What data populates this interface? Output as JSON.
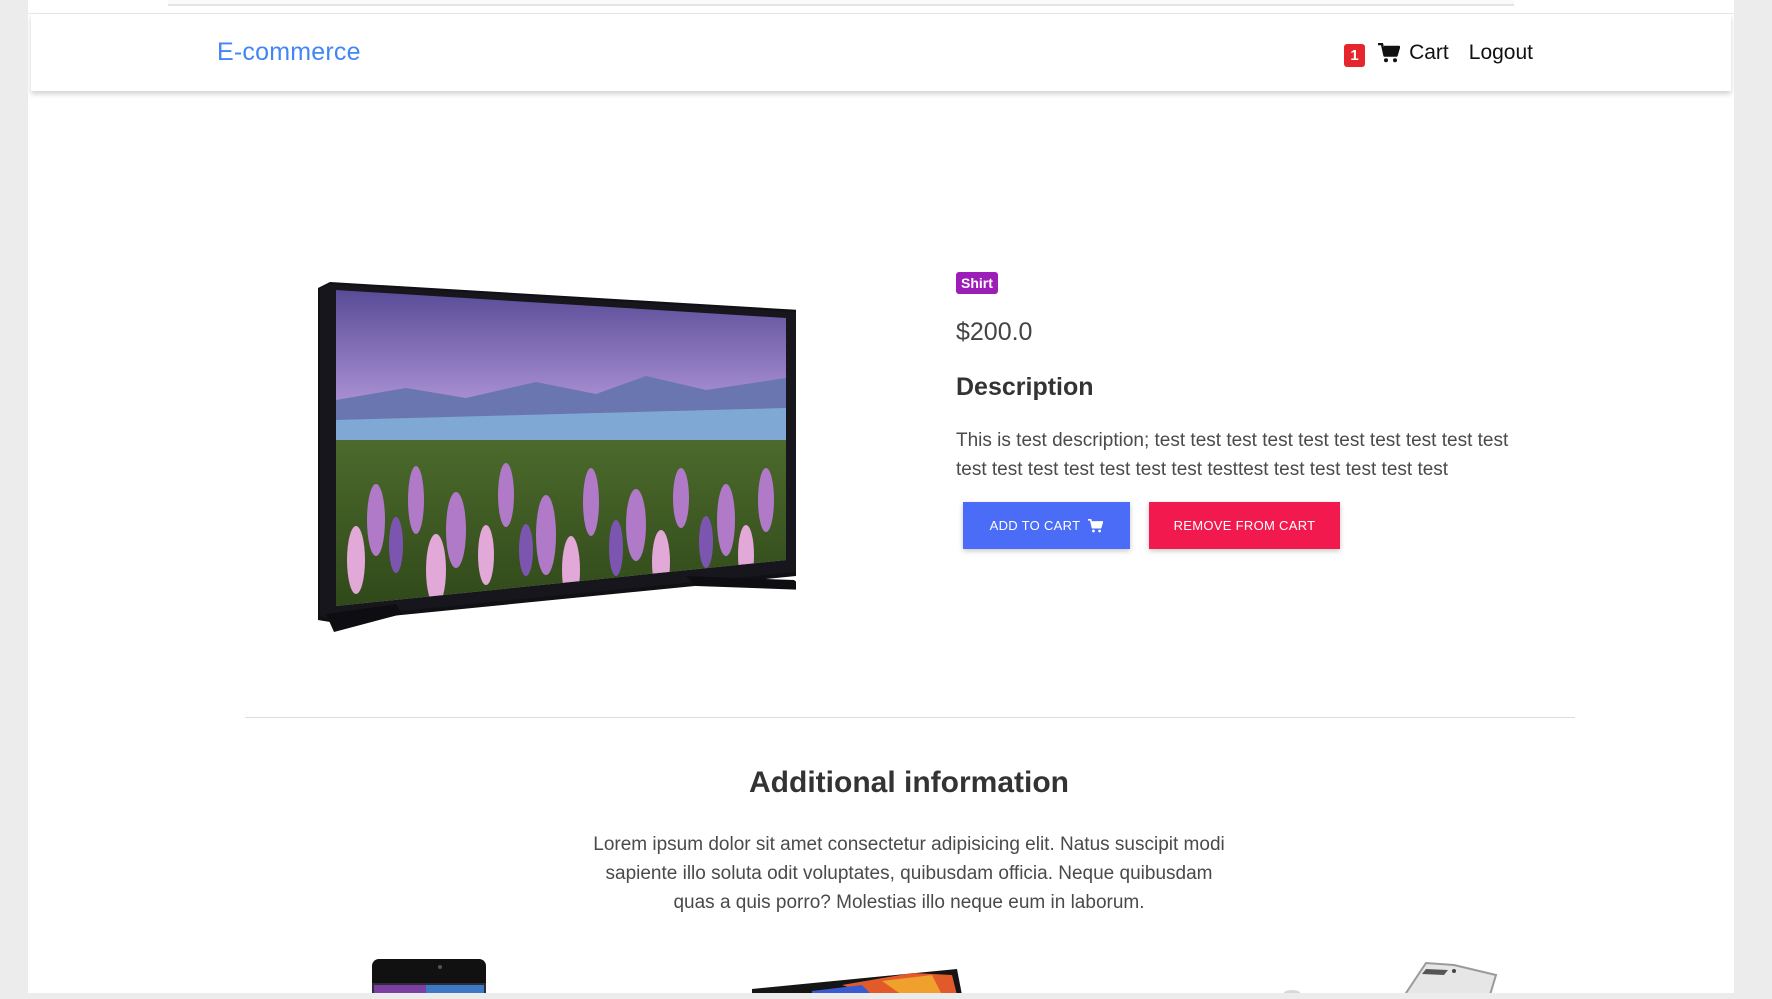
{
  "navbar": {
    "brand": "E-commerce",
    "cart_count": "1",
    "cart_label": "Cart",
    "logout_label": "Logout"
  },
  "product": {
    "image_icon": "television-image",
    "category": "Shirt",
    "price": "$200.0",
    "description_title": "Description",
    "description": "This is test description; test test test test test test test test test test test test test test test test test testtest test test test test test",
    "add_to_cart_label": "ADD TO CART",
    "remove_from_cart_label": "REMOVE FROM CART"
  },
  "additional": {
    "title": "Additional information",
    "text": "Lorem ipsum dolor sit amet consectetur adipisicing elit. Natus suscipit modi sapiente illo soluta odit voluptates, quibusdam officia. Neque quibusdam quas a quis porro? Molestias illo neque eum in laborum."
  },
  "colors": {
    "brand": "#4285f4",
    "badge": "#e5262d",
    "category_badge": "#9c1db8",
    "add_button": "#4a6cf7",
    "remove_button": "#f2194f"
  }
}
